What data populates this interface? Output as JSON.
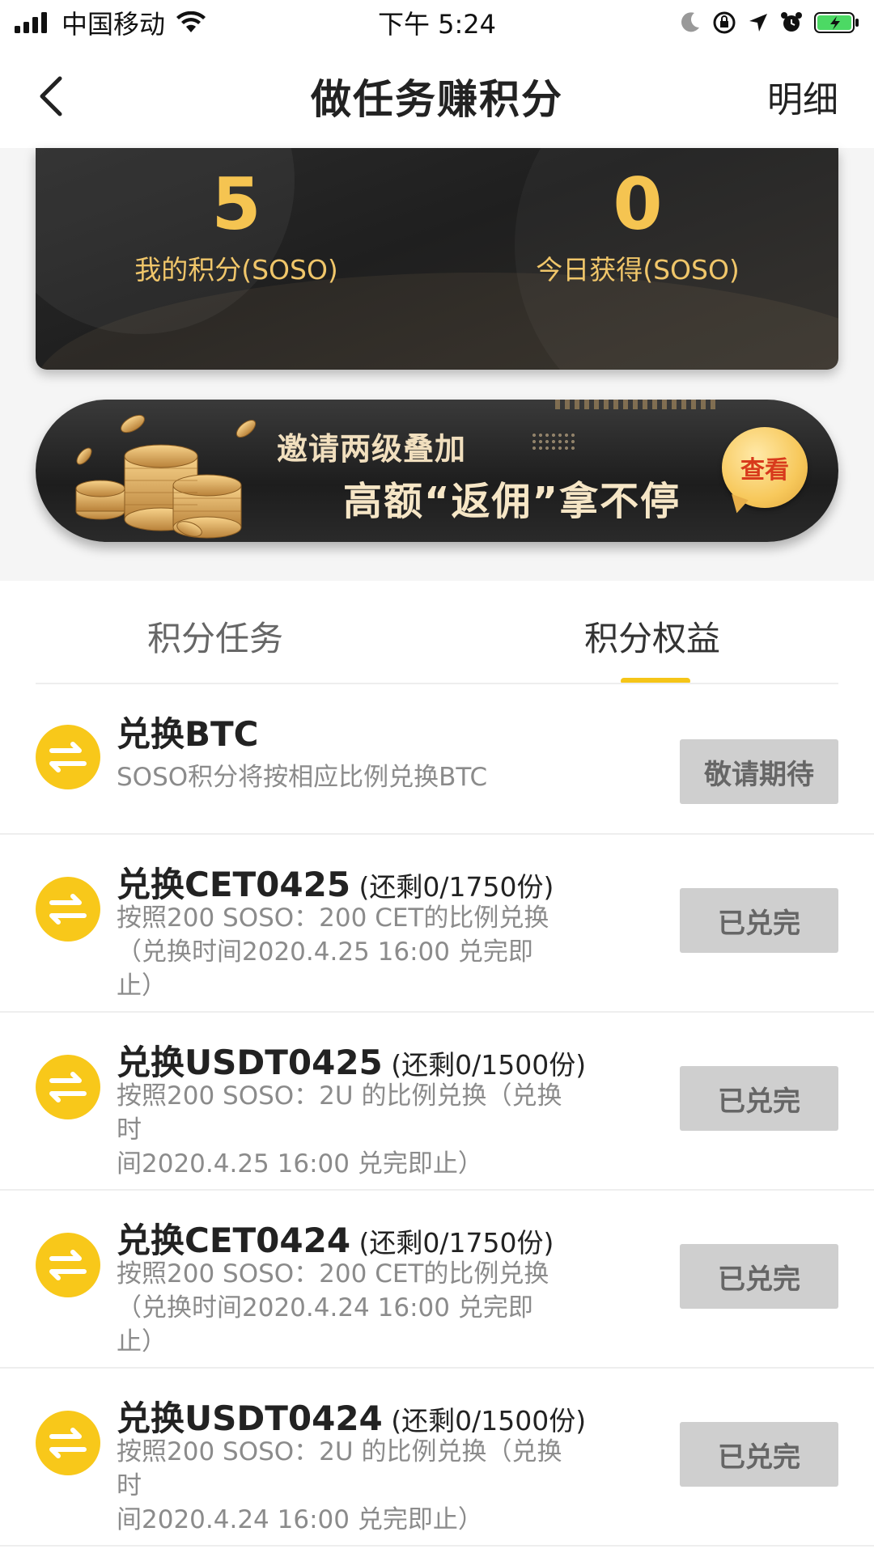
{
  "status_bar": {
    "carrier": "中国移动",
    "time": "下午 5:24"
  },
  "nav": {
    "title": "做任务赚积分",
    "detail_label": "明细",
    "back_icon": "chevron-left-icon"
  },
  "points": {
    "my_points_value": "5",
    "my_points_label": "我的积分(SOSO)",
    "today_value": "0",
    "today_label": "今日获得(SOSO)"
  },
  "banner": {
    "line1": "邀请两级叠加",
    "line2": "高额“返佣”拿不停",
    "button_label": "查看"
  },
  "tabs": [
    {
      "label": "积分任务",
      "active": false
    },
    {
      "label": "积分权益",
      "active": true
    }
  ],
  "colors": {
    "accent": "#f5c518",
    "icon_bg": "#f8c81a",
    "points_gold": "#f5c451",
    "disabled_button": "#cfcfcf"
  },
  "rewards": [
    {
      "title": "兑换BTC",
      "remaining": "",
      "desc_line1": "SOSO积分将按相应比例兑换BTC",
      "desc_line2": "",
      "button_label": "敬请期待",
      "icon": "swap-arrows-icon"
    },
    {
      "title": "兑换CET0425",
      "remaining": " (还剩0/1750份)",
      "desc_line1": "按照200 SOSO：200 CET的比例兑换",
      "desc_line2": "（兑换时间2020.4.25 16:00 兑完即止）",
      "button_label": "已兑完",
      "icon": "swap-arrows-icon"
    },
    {
      "title": "兑换USDT0425",
      "remaining": " (还剩0/1500份)",
      "desc_line1": "按照200 SOSO：2U 的比例兑换（兑换时",
      "desc_line2": "间2020.4.25 16:00 兑完即止）",
      "button_label": "已兑完",
      "icon": "swap-arrows-icon"
    },
    {
      "title": "兑换CET0424",
      "remaining": " (还剩0/1750份)",
      "desc_line1": "按照200 SOSO：200 CET的比例兑换",
      "desc_line2": "（兑换时间2020.4.24 16:00 兑完即止）",
      "button_label": "已兑完",
      "icon": "swap-arrows-icon"
    },
    {
      "title": "兑换USDT0424",
      "remaining": " (还剩0/1500份)",
      "desc_line1": "按照200 SOSO：2U 的比例兑换（兑换时",
      "desc_line2": "间2020.4.24 16:00 兑完即止）",
      "button_label": "已兑完",
      "icon": "swap-arrows-icon"
    }
  ]
}
